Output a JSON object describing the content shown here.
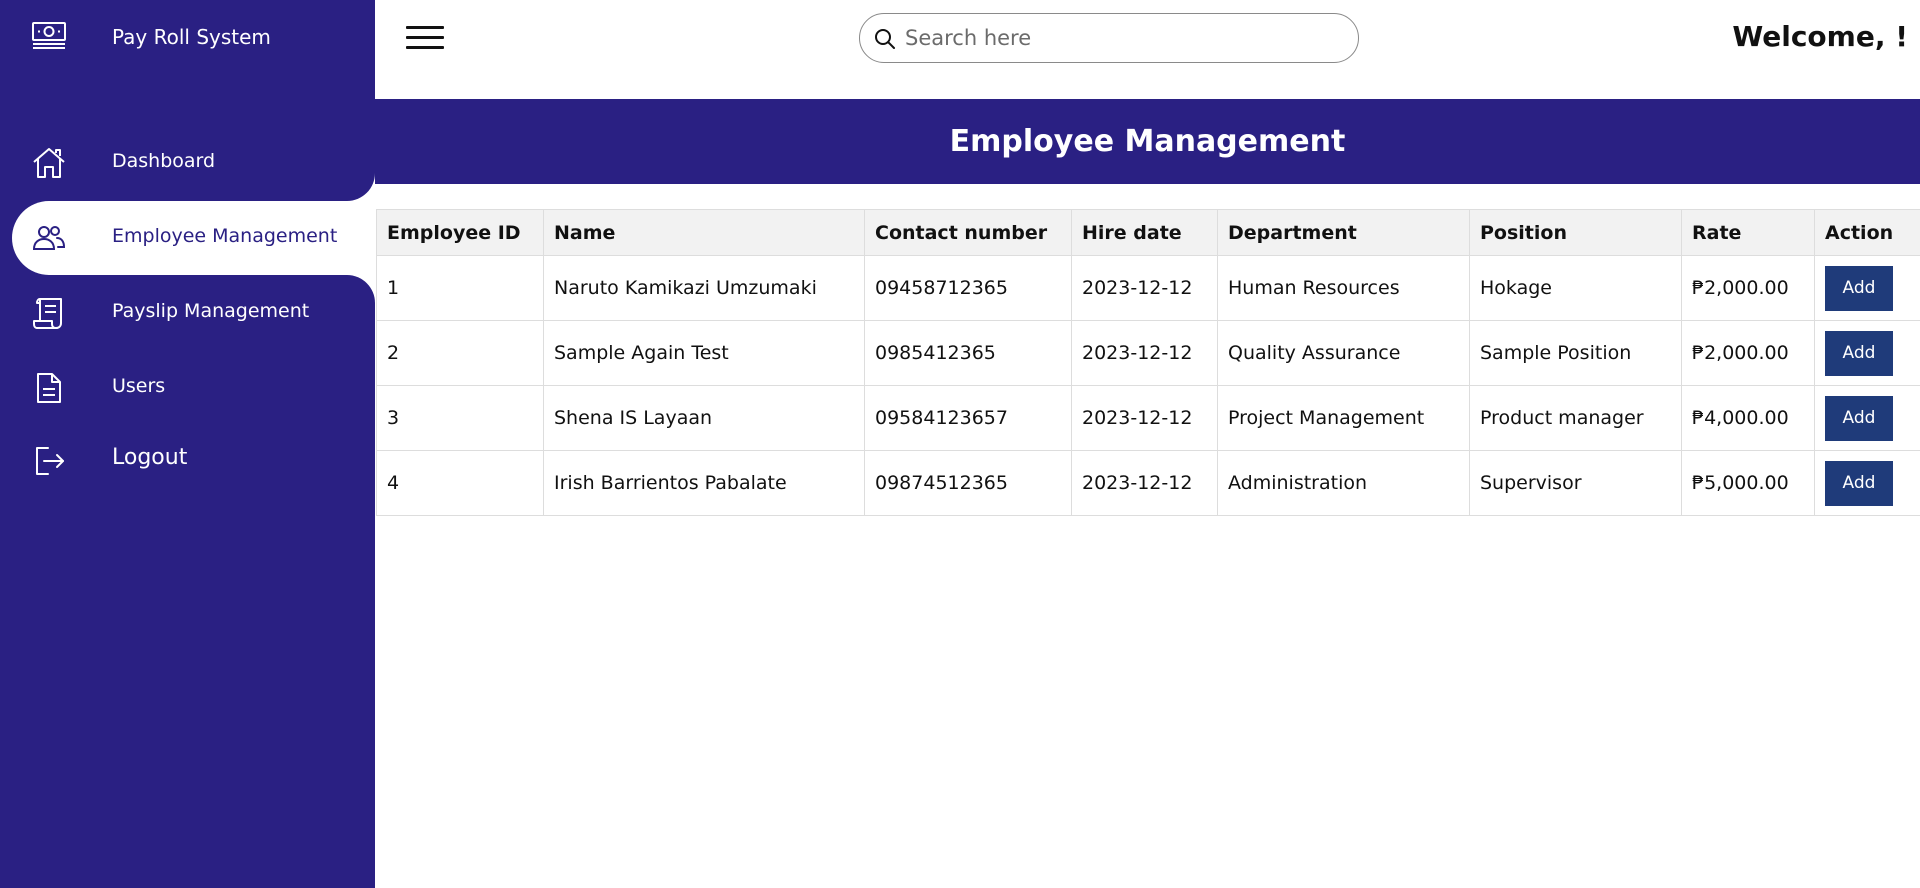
{
  "app": {
    "title": "Pay Roll System"
  },
  "sidebar": {
    "items": [
      {
        "label": "Dashboard",
        "icon": "home-icon"
      },
      {
        "label": "Employee Management",
        "icon": "users-icon",
        "active": true
      },
      {
        "label": "Payslip Management",
        "icon": "receipt-icon"
      },
      {
        "label": "Users",
        "icon": "document-icon"
      },
      {
        "label": "Logout",
        "icon": "logout-icon"
      }
    ]
  },
  "header": {
    "search_placeholder": "Search here",
    "welcome": "Welcome, !"
  },
  "page": {
    "title": "Employee Management"
  },
  "table": {
    "columns": [
      "Employee ID",
      "Name",
      "Contact number",
      "Hire date",
      "Department",
      "Position",
      "Rate",
      "Action"
    ],
    "rows": [
      {
        "id": "1",
        "name": "Naruto Kamikazi Umzumaki",
        "contact": "09458712365",
        "hire_date": "2023-12-12",
        "department": "Human Resources",
        "position": "Hokage",
        "rate": "₱2,000.00",
        "action": "Add"
      },
      {
        "id": "2",
        "name": "Sample Again Test",
        "contact": "0985412365",
        "hire_date": "2023-12-12",
        "department": "Quality Assurance",
        "position": "Sample Position",
        "rate": "₱2,000.00",
        "action": "Add"
      },
      {
        "id": "3",
        "name": "Shena IS Layaan",
        "contact": "09584123657",
        "hire_date": "2023-12-12",
        "department": "Project Management",
        "position": "Product manager",
        "rate": "₱4,000.00",
        "action": "Add"
      },
      {
        "id": "4",
        "name": "Irish Barrientos Pabalate",
        "contact": "09874512365",
        "hire_date": "2023-12-12",
        "department": "Administration",
        "position": "Supervisor",
        "rate": "₱5,000.00",
        "action": "Add"
      }
    ]
  },
  "colors": {
    "primary": "#2a2083",
    "button": "#1f3b7a",
    "header_row": "#f2f2f2"
  }
}
